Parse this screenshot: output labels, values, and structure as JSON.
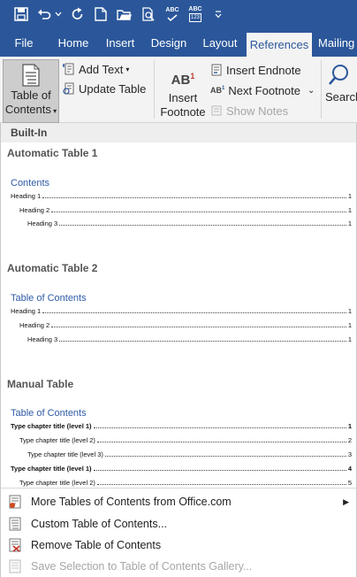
{
  "quick_access": {
    "icons": [
      "save-icon",
      "undo-icon",
      "undo-dropdown-icon",
      "redo-icon",
      "new-document-icon",
      "open-folder-icon",
      "print-preview-icon",
      "spelling-icon",
      "spelling-check-icon",
      "customize-qat-icon"
    ],
    "abc": "ABC",
    "abc2": "ABC",
    "abc2_sub": "123"
  },
  "tabs": {
    "file": "File",
    "home": "Home",
    "insert": "Insert",
    "design": "Design",
    "layout": "Layout",
    "references": "References",
    "mailings": "Mailing"
  },
  "ribbon": {
    "toc_line1": "Table of",
    "toc_line2": "Contents",
    "add_text": "Add Text",
    "update_table": "Update Table",
    "insert_footnote_line1": "Insert",
    "insert_footnote_line2": "Footnote",
    "footnote_icon_text": "AB",
    "footnote_icon_sup": "1",
    "next_icon_text": "AB",
    "next_icon_sup": "1",
    "insert_endnote": "Insert Endnote",
    "next_footnote": "Next Footnote",
    "show_notes": "Show Notes",
    "search": "Search"
  },
  "gallery": {
    "section_header": "Built-In",
    "items": [
      {
        "title": "Automatic Table 1",
        "heading": "Contents",
        "lines": [
          {
            "label": "Heading 1",
            "page": "1"
          },
          {
            "label": "Heading 2",
            "page": "1"
          },
          {
            "label": "Heading 3",
            "page": "1"
          }
        ]
      },
      {
        "title": "Automatic Table 2",
        "heading": "Table of Contents",
        "lines": [
          {
            "label": "Heading 1",
            "page": "1"
          },
          {
            "label": "Heading 2",
            "page": "1"
          },
          {
            "label": "Heading 3",
            "page": "1"
          }
        ]
      },
      {
        "title": "Manual Table",
        "heading": "Table of Contents",
        "lines": [
          {
            "label": "Type chapter title (level 1)",
            "page": "1"
          },
          {
            "label": "Type chapter title (level 2)",
            "page": "2"
          },
          {
            "label": "Type chapter title (level 3)",
            "page": "3"
          },
          {
            "label": "Type chapter title (level 1)",
            "page": "4"
          },
          {
            "label": "Type chapter title (level 2)",
            "page": "5"
          }
        ]
      }
    ]
  },
  "menu": {
    "more_tables": "More Tables of Contents from Office.com",
    "custom_toc": "Custom Table of Contents...",
    "remove_toc": "Remove Table of Contents",
    "save_selection": "Save Selection to Table of Contents Gallery..."
  },
  "colors": {
    "title_bar": "#2b579a",
    "ribbon_bg": "#f3f3f3",
    "toc_heading": "#2e5aa6",
    "disabled": "#a6a6a6"
  }
}
